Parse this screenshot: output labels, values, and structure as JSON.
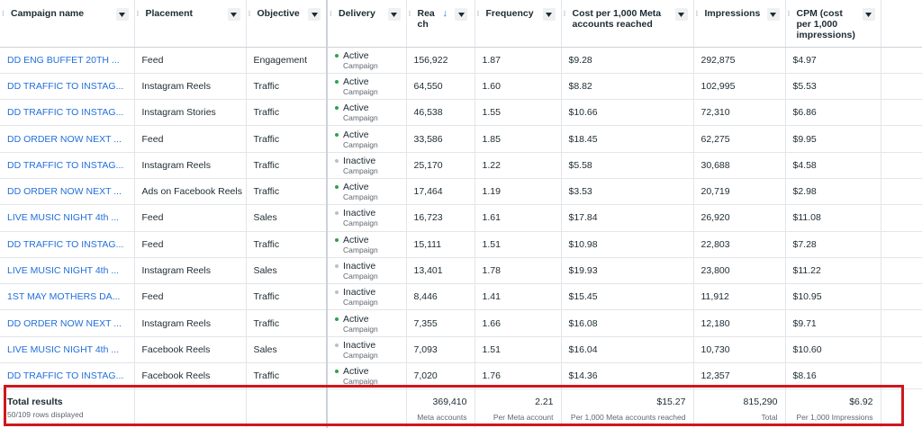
{
  "headers": {
    "campaign": "Campaign name",
    "placement": "Placement",
    "objective": "Objective",
    "delivery": "Delivery",
    "reach": "Rea ch",
    "frequency": "Frequency",
    "cpm_reached": "Cost per 1,000 Meta accounts reached",
    "impressions": "Impressions",
    "cpm": "CPM (cost per 1,000 impressions)"
  },
  "rows": [
    {
      "campaign": "DD ENG BUFFET 20TH ...",
      "placement": "Feed",
      "objective": "Engagement",
      "status": "Active",
      "status_sub": "Campaign",
      "reach": "156,922",
      "frequency": "1.87",
      "cost_reached": "$9.28",
      "impressions": "292,875",
      "cpm": "$4.97"
    },
    {
      "campaign": "DD TRAFFIC TO INSTAG...",
      "placement": "Instagram Reels",
      "objective": "Traffic",
      "status": "Active",
      "status_sub": "Campaign",
      "reach": "64,550",
      "frequency": "1.60",
      "cost_reached": "$8.82",
      "impressions": "102,995",
      "cpm": "$5.53"
    },
    {
      "campaign": "DD TRAFFIC TO INSTAG...",
      "placement": "Instagram Stories",
      "objective": "Traffic",
      "status": "Active",
      "status_sub": "Campaign",
      "reach": "46,538",
      "frequency": "1.55",
      "cost_reached": "$10.66",
      "impressions": "72,310",
      "cpm": "$6.86"
    },
    {
      "campaign": "DD ORDER NOW NEXT ...",
      "placement": "Feed",
      "objective": "Traffic",
      "status": "Active",
      "status_sub": "Campaign",
      "reach": "33,586",
      "frequency": "1.85",
      "cost_reached": "$18.45",
      "impressions": "62,275",
      "cpm": "$9.95"
    },
    {
      "campaign": "DD TRAFFIC TO INSTAG...",
      "placement": "Instagram Reels",
      "objective": "Traffic",
      "status": "Inactive",
      "status_sub": "Campaign",
      "reach": "25,170",
      "frequency": "1.22",
      "cost_reached": "$5.58",
      "impressions": "30,688",
      "cpm": "$4.58"
    },
    {
      "campaign": "DD ORDER NOW NEXT ...",
      "placement": "Ads on Facebook Reels",
      "objective": "Traffic",
      "status": "Active",
      "status_sub": "Campaign",
      "reach": "17,464",
      "frequency": "1.19",
      "cost_reached": "$3.53",
      "impressions": "20,719",
      "cpm": "$2.98"
    },
    {
      "campaign": "LIVE MUSIC NIGHT 4th ...",
      "placement": "Feed",
      "objective": "Sales",
      "status": "Inactive",
      "status_sub": "Campaign",
      "reach": "16,723",
      "frequency": "1.61",
      "cost_reached": "$17.84",
      "impressions": "26,920",
      "cpm": "$11.08"
    },
    {
      "campaign": "DD TRAFFIC TO INSTAG...",
      "placement": "Feed",
      "objective": "Traffic",
      "status": "Active",
      "status_sub": "Campaign",
      "reach": "15,111",
      "frequency": "1.51",
      "cost_reached": "$10.98",
      "impressions": "22,803",
      "cpm": "$7.28"
    },
    {
      "campaign": "LIVE MUSIC NIGHT 4th ...",
      "placement": "Instagram Reels",
      "objective": "Sales",
      "status": "Inactive",
      "status_sub": "Campaign",
      "reach": "13,401",
      "frequency": "1.78",
      "cost_reached": "$19.93",
      "impressions": "23,800",
      "cpm": "$11.22"
    },
    {
      "campaign": "1ST MAY MOTHERS DA...",
      "placement": "Feed",
      "objective": "Traffic",
      "status": "Inactive",
      "status_sub": "Campaign",
      "reach": "8,446",
      "frequency": "1.41",
      "cost_reached": "$15.45",
      "impressions": "11,912",
      "cpm": "$10.95"
    },
    {
      "campaign": "DD ORDER NOW NEXT ...",
      "placement": "Instagram Reels",
      "objective": "Traffic",
      "status": "Active",
      "status_sub": "Campaign",
      "reach": "7,355",
      "frequency": "1.66",
      "cost_reached": "$16.08",
      "impressions": "12,180",
      "cpm": "$9.71"
    },
    {
      "campaign": "LIVE MUSIC NIGHT 4th ...",
      "placement": "Facebook Reels",
      "objective": "Sales",
      "status": "Inactive",
      "status_sub": "Campaign",
      "reach": "7,093",
      "frequency": "1.51",
      "cost_reached": "$16.04",
      "impressions": "10,730",
      "cpm": "$10.60"
    },
    {
      "campaign": "DD TRAFFIC TO INSTAG...",
      "placement": "Facebook Reels",
      "objective": "Traffic",
      "status": "Active",
      "status_sub": "Campaign",
      "reach": "7,020",
      "frequency": "1.76",
      "cost_reached": "$14.36",
      "impressions": "12,357",
      "cpm": "$8.16"
    }
  ],
  "totals": {
    "label": "Total results",
    "sub": "50/109 rows displayed",
    "reach": "369,410",
    "reach_sub": "Meta accounts",
    "frequency": "2.21",
    "frequency_sub": "Per Meta account",
    "cost_reached": "$15.27",
    "cost_reached_sub": "Per 1,000 Meta accounts reached",
    "impressions": "815,290",
    "impressions_sub": "Total",
    "cpm": "$6.92",
    "cpm_sub": "Per 1,000 Impressions"
  },
  "colors": {
    "active": "#31a24c",
    "inactive": "#bcc0c4",
    "link": "#216fdb",
    "highlight": "#d0161d"
  },
  "icons": {
    "sort": "arrow-down-icon",
    "dropdown": "chevron-down-icon",
    "grip": "drag-handle-icon"
  }
}
